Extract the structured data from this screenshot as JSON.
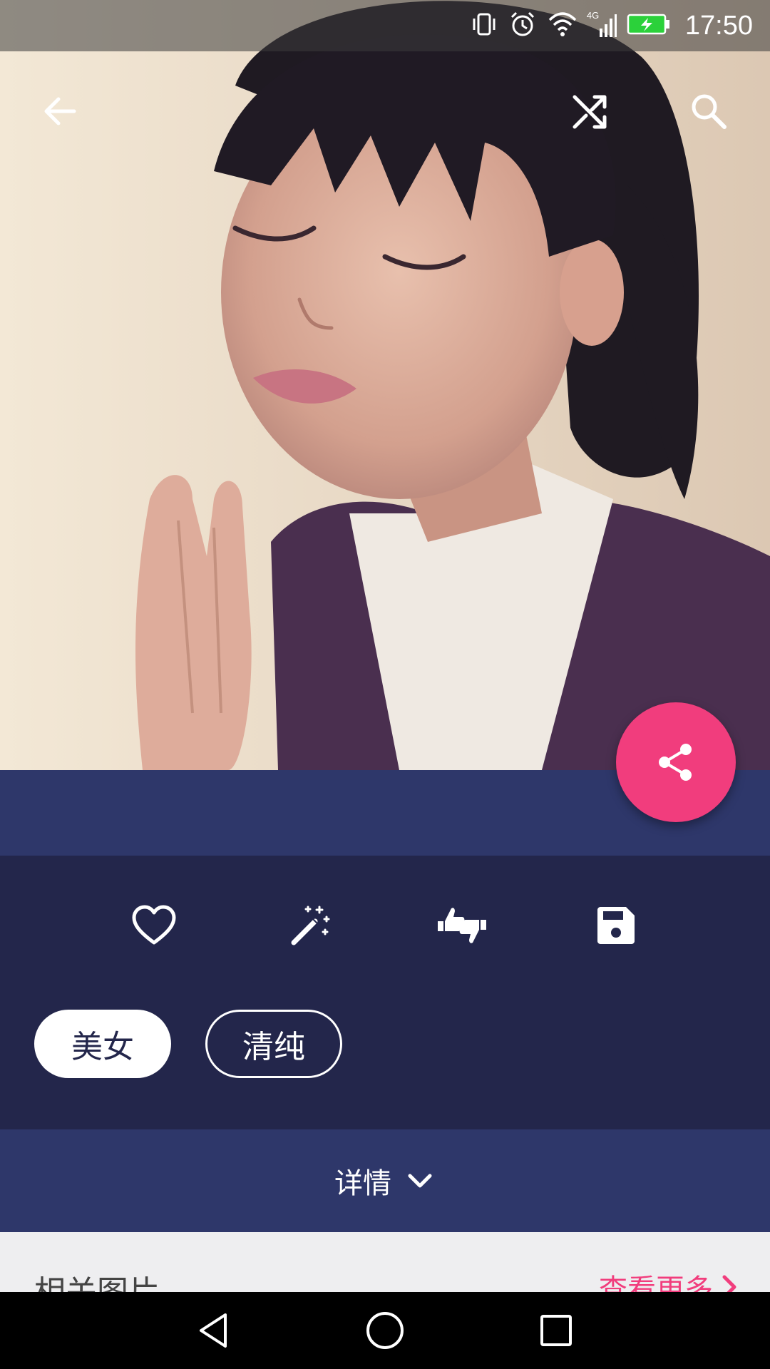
{
  "status_bar": {
    "time": "17:50",
    "network_label": "4G",
    "icons": [
      "vibrate-icon",
      "alarm-icon",
      "wifi-icon",
      "cellular-signal-icon",
      "battery-charging-icon"
    ]
  },
  "top_bar": {
    "icons": [
      "back-arrow-icon",
      "shuffle-icon",
      "search-icon"
    ]
  },
  "photo": {
    "subject": "photo"
  },
  "fab": {
    "icon": "share-icon",
    "color": "#f13d7d"
  },
  "actions": {
    "icons": [
      "heart-icon",
      "magic-wand-icon",
      "thumbs-up-down-icon",
      "save-icon"
    ]
  },
  "tags": [
    {
      "label": "美女",
      "selected": true
    },
    {
      "label": "清纯",
      "selected": false
    }
  ],
  "details": {
    "label": "详情",
    "icon": "chevron-down-icon"
  },
  "related": {
    "title": "相关图片",
    "more_label": "查看更多",
    "more_icon": "chevron-right-icon"
  },
  "nav_bar": {
    "icons": [
      "nav-back-icon",
      "nav-home-icon",
      "nav-recents-icon"
    ]
  },
  "colors": {
    "accent": "#f13d7d",
    "band": "#2e376a",
    "panel": "#23264b"
  }
}
